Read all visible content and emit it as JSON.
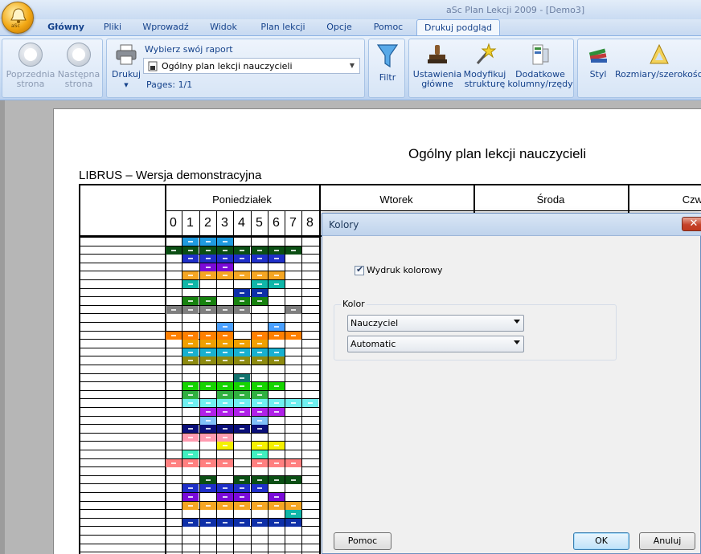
{
  "app": {
    "title": "aSc Plan Lekcji 2009  - [Demo3]",
    "orb_label": "aSc"
  },
  "ribbon_tabs": [
    "Główny",
    "Pliki",
    "Wprowadź",
    "Widok",
    "Plan lekcji",
    "Opcje",
    "Pomoc",
    "Drukuj podgląd"
  ],
  "ribbon": {
    "prev_label": "Poprzednia strona",
    "prev_l1": "Poprzednia",
    "prev_l2": "strona",
    "next_l1": "Następna",
    "next_l2": "strona",
    "print_label": "Drukuj",
    "report_label": "Wybierz swój raport",
    "report_value": "Ogólny plan lekcji nauczycieli",
    "pages": "Pages: 1/1",
    "filter_label": "Filtr",
    "settings_l1": "Ustawienia",
    "settings_l2": "główne",
    "modify_l1": "Modyfikuj",
    "modify_l2": "strukturę",
    "extra_l1": "Dodatkowe",
    "extra_l2": "kolumny/rzędy",
    "style_label": "Styl",
    "size_label": "Rozmiary/szerokości"
  },
  "document": {
    "title": "Ogólny plan lekcji nauczycieli",
    "subtitle": "LIBRUS – Wersja demonstracyjna",
    "days": [
      "Poniedziałek",
      "Wtorek",
      "Środa",
      "Czw"
    ],
    "periods": [
      "0",
      "1",
      "2",
      "3",
      "4",
      "5",
      "6",
      "7",
      "8"
    ]
  },
  "dialog": {
    "title": "Kolory",
    "checkbox_label": "Wydruk kolorowy",
    "checkbox_checked": true,
    "group_label": "Kolor",
    "dropdown1": "Nauczyciel",
    "dropdown2": "Automatic",
    "help_button": "Pomoc",
    "ok_button": "OK",
    "cancel_button": "Anuluj",
    "close_glyph": "✕"
  },
  "colors": {
    "ribbon_text": "#15428b",
    "active_tab": "#f2f7fd",
    "close_red": "#c5432a"
  }
}
